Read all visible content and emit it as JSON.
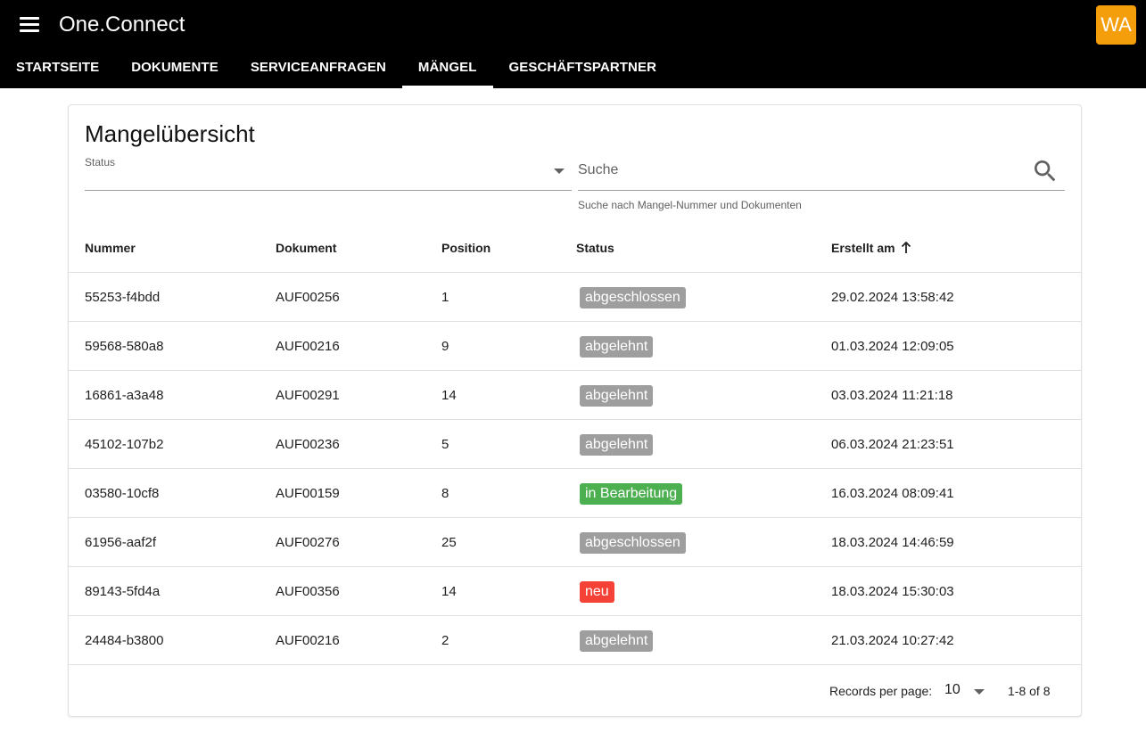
{
  "app": {
    "title": "One.Connect",
    "avatar_initials": "WA",
    "avatar_color": "#f59e0b"
  },
  "nav": {
    "tabs": [
      {
        "label": "STARTSEITE",
        "active": false
      },
      {
        "label": "DOKUMENTE",
        "active": false
      },
      {
        "label": "SERVICEANFRAGEN",
        "active": false
      },
      {
        "label": "MÄNGEL",
        "active": true
      },
      {
        "label": "GESCHÄFTSPARTNER",
        "active": false
      }
    ]
  },
  "page": {
    "title": "Mangelübersicht"
  },
  "filters": {
    "status_label": "Status",
    "search_placeholder": "Suche",
    "search_hint": "Suche nach Mangel-Nummer und Dokumenten"
  },
  "table": {
    "headers": {
      "nummer": "Nummer",
      "dokument": "Dokument",
      "position": "Position",
      "status": "Status",
      "erstellt": "Erstellt am"
    },
    "rows": [
      {
        "nummer": "55253-f4bdd",
        "dokument": "AUF00256",
        "position": "1",
        "status": "abgeschlossen",
        "status_color": "#9e9e9e",
        "erstellt": "29.02.2024 13:58:42"
      },
      {
        "nummer": "59568-580a8",
        "dokument": "AUF00216",
        "position": "9",
        "status": "abgelehnt",
        "status_color": "#9e9e9e",
        "erstellt": "01.03.2024 12:09:05"
      },
      {
        "nummer": "16861-a3a48",
        "dokument": "AUF00291",
        "position": "14",
        "status": "abgelehnt",
        "status_color": "#9e9e9e",
        "erstellt": "03.03.2024 11:21:18"
      },
      {
        "nummer": "45102-107b2",
        "dokument": "AUF00236",
        "position": "5",
        "status": "abgelehnt",
        "status_color": "#9e9e9e",
        "erstellt": "06.03.2024 21:23:51"
      },
      {
        "nummer": "03580-10cf8",
        "dokument": "AUF00159",
        "position": "8",
        "status": "in Bearbeitung",
        "status_color": "#4caf50",
        "erstellt": "16.03.2024 08:09:41"
      },
      {
        "nummer": "61956-aaf2f",
        "dokument": "AUF00276",
        "position": "25",
        "status": "abgeschlossen",
        "status_color": "#9e9e9e",
        "erstellt": "18.03.2024 14:46:59"
      },
      {
        "nummer": "89143-5fd4a",
        "dokument": "AUF00356",
        "position": "14",
        "status": "neu",
        "status_color": "#f44336",
        "erstellt": "18.03.2024 15:30:03"
      },
      {
        "nummer": "24484-b3800",
        "dokument": "AUF00216",
        "position": "2",
        "status": "abgelehnt",
        "status_color": "#9e9e9e",
        "erstellt": "21.03.2024 10:27:42"
      }
    ]
  },
  "pagination": {
    "records_per_page_label": "Records per page:",
    "records_per_page_value": "10",
    "range": "1-8 of 8"
  }
}
